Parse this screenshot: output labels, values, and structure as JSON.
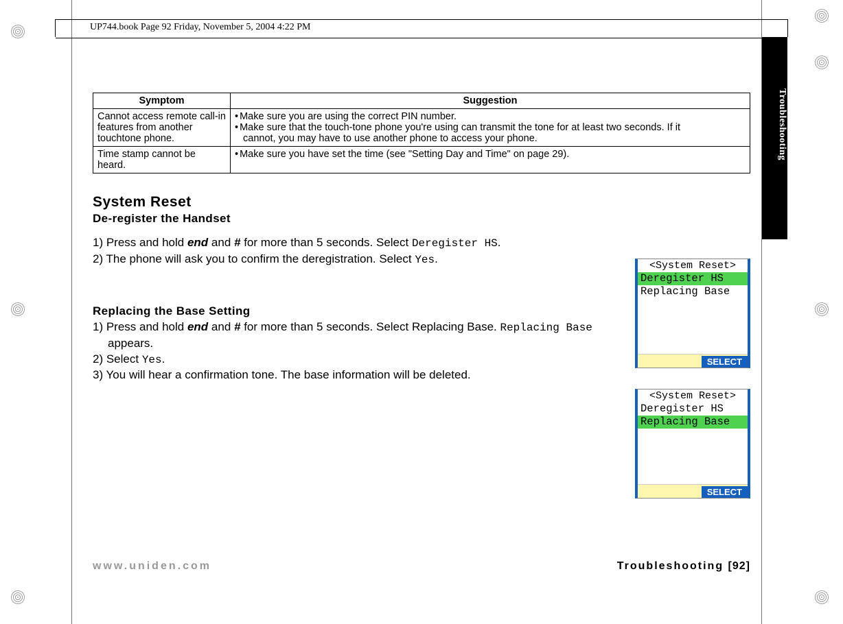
{
  "frame_header": "UP744.book  Page 92  Friday, November 5, 2004  4:22 PM",
  "side_tab": "Troubleshooting",
  "table": {
    "headers": {
      "symptom": "Symptom",
      "suggestion": "Suggestion"
    },
    "rows": [
      {
        "symptom": "Cannot access remote call-in features from another touchtone phone.",
        "sugg1": "Make sure you are using the correct PIN number.",
        "sugg2a": "Make sure that the touch-tone phone you're using can transmit the tone for at least two seconds. If it",
        "sugg2b": "cannot, you may have to use another phone to access your phone."
      },
      {
        "symptom": "Time stamp cannot be heard.",
        "sugg1": "Make sure you have set the time (see \"Setting Day and Time\" on page 29)."
      }
    ]
  },
  "headings": {
    "system_reset": "System Reset",
    "deregister": "De-register the Handset",
    "replacing": "Replacing the Base Setting"
  },
  "proc_dereg": {
    "l1a": "1) Press and hold ",
    "l1b": "end",
    "l1c": " and ",
    "l1d": "#",
    "l1e": " for more than 5 seconds. Select ",
    "l1f": "Deregister HS",
    "l1g": ".",
    "l2a": "2) The phone will ask you to confirm the deregistration. Select ",
    "l2b": "Yes",
    "l2c": "."
  },
  "proc_repl": {
    "l1a": "1) Press and hold ",
    "l1b": "end",
    "l1c": " and ",
    "l1d": "#",
    "l1e": " for more than 5 seconds. Select Replacing Base. ",
    "l1f": "Replacing Base",
    "l1g": " appears.",
    "l2a": "2) Select ",
    "l2b": "Yes",
    "l2c": ".",
    "l3": "3) You will hear a confirmation tone. The base information will be deleted."
  },
  "lcd": {
    "title": "<System Reset>",
    "row_dereg": "Deregister HS",
    "row_repl": "Replacing Base",
    "select": "SELECT"
  },
  "footer": {
    "url": "www.uniden.com",
    "section": "Troubleshooting",
    "page": "[92]"
  }
}
